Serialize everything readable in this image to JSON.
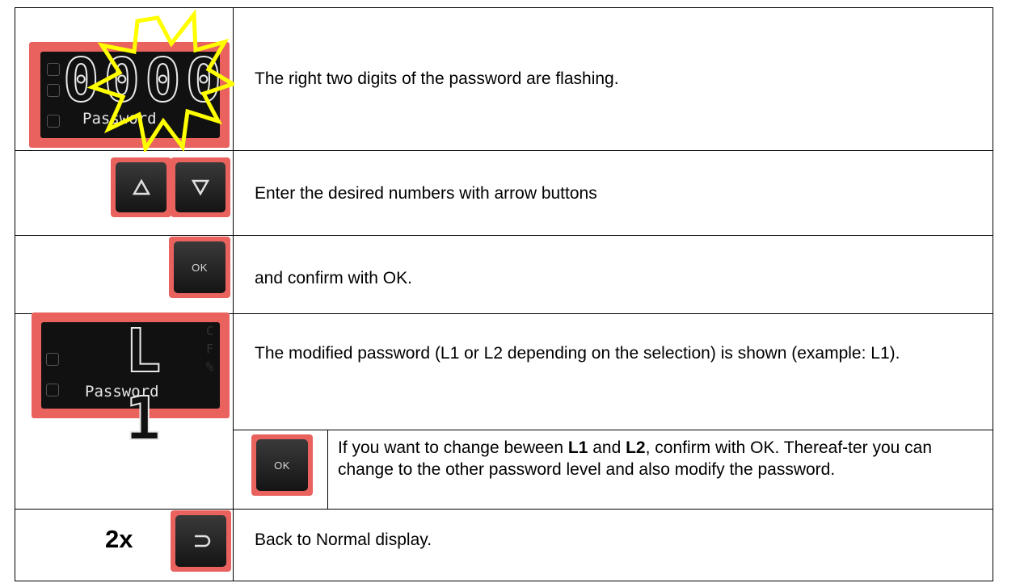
{
  "rows": [
    {
      "display": {
        "digits": "0000",
        "label": "Password",
        "flash_effect": "yellow-starburst"
      },
      "text": "The right two digits of the password are flashing."
    },
    {
      "buttons": [
        {
          "icon": "up-triangle-icon"
        },
        {
          "icon": "down-triangle-icon"
        }
      ],
      "text": "Enter the desired numbers with arrow buttons"
    },
    {
      "button_label": "OK",
      "text": "and confirm with OK."
    },
    {
      "display": {
        "digits": "L 1",
        "label": "Password",
        "side_letters": [
          "C",
          "F",
          "%"
        ]
      },
      "text": "The modified password (L1 or L2 depending on the selection) is shown (example: L1).",
      "sub": {
        "button_label": "OK",
        "text_before": "If you want to change beween ",
        "bold1": "L1",
        "text_mid": " and ",
        "bold2": "L2",
        "text_after": ", confirm with OK. Thereaf-ter you can change to the other password level and also modify the password."
      }
    },
    {
      "count": "2x",
      "button_icon": "return-icon",
      "text": "Back to Normal display."
    }
  ],
  "colors": {
    "device_red": "#e9625e",
    "button_dark": "#1e1e1e",
    "flash_yellow": "#ffff00",
    "text": "#000000"
  }
}
